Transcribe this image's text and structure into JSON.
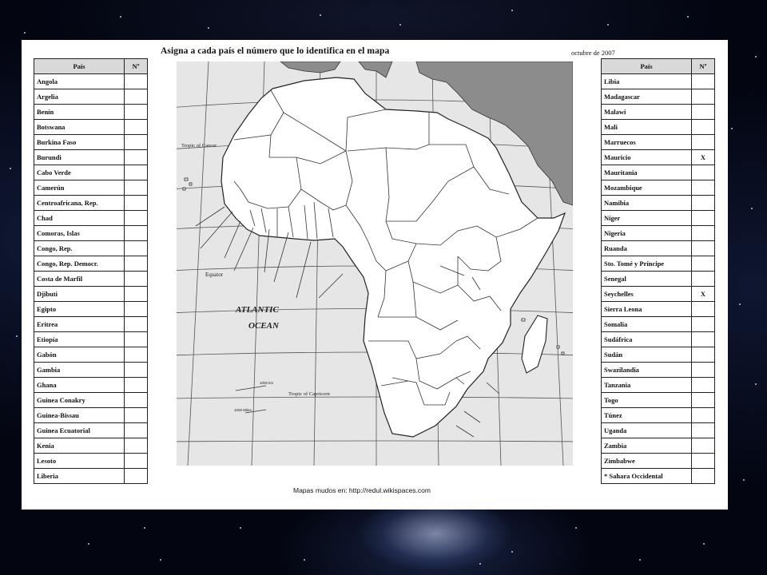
{
  "worksheet": {
    "title": "Asigna a cada país el número que lo identifica en el mapa",
    "date": "octubre de 2007",
    "footer": "Mapas mudos en:  http://redul.wikispaces.com"
  },
  "table_headers": {
    "country": "País",
    "number": "Nº"
  },
  "left_countries": [
    {
      "name": "Angola",
      "mark": ""
    },
    {
      "name": "Argelia",
      "mark": ""
    },
    {
      "name": "Benín",
      "mark": ""
    },
    {
      "name": "Botswana",
      "mark": ""
    },
    {
      "name": "Burkina Faso",
      "mark": ""
    },
    {
      "name": "Burundi",
      "mark": ""
    },
    {
      "name": "Cabo Verde",
      "mark": ""
    },
    {
      "name": "Camerún",
      "mark": ""
    },
    {
      "name": "Centroafricana, Rep.",
      "mark": ""
    },
    {
      "name": "Chad",
      "mark": ""
    },
    {
      "name": "Comoras, Islas",
      "mark": ""
    },
    {
      "name": "Congo, Rep.",
      "mark": ""
    },
    {
      "name": "Congo, Rep. Democr.",
      "mark": ""
    },
    {
      "name": "Costa de Marfil",
      "mark": ""
    },
    {
      "name": "Djibuti",
      "mark": ""
    },
    {
      "name": "Egipto",
      "mark": ""
    },
    {
      "name": "Eritrea",
      "mark": ""
    },
    {
      "name": "Etiopía",
      "mark": ""
    },
    {
      "name": "Gabón",
      "mark": ""
    },
    {
      "name": "Gambia",
      "mark": ""
    },
    {
      "name": "Ghana",
      "mark": ""
    },
    {
      "name": "Guinea Conakry",
      "mark": ""
    },
    {
      "name": "Guinea-Bissau",
      "mark": ""
    },
    {
      "name": "Guinea Ecuatorial",
      "mark": ""
    },
    {
      "name": "Kenia",
      "mark": ""
    },
    {
      "name": "Lesoto",
      "mark": ""
    },
    {
      "name": "Liberia",
      "mark": ""
    }
  ],
  "right_countries": [
    {
      "name": "Libia",
      "mark": ""
    },
    {
      "name": "Madagascar",
      "mark": ""
    },
    {
      "name": "Malawi",
      "mark": ""
    },
    {
      "name": "Mali",
      "mark": ""
    },
    {
      "name": "Marruecos",
      "mark": ""
    },
    {
      "name": "Mauricio",
      "mark": "X"
    },
    {
      "name": "Mauritania",
      "mark": ""
    },
    {
      "name": "Mozambique",
      "mark": ""
    },
    {
      "name": "Namibia",
      "mark": ""
    },
    {
      "name": "Níger",
      "mark": ""
    },
    {
      "name": "Nigeria",
      "mark": ""
    },
    {
      "name": "Ruanda",
      "mark": ""
    },
    {
      "name": "Sto. Tomé y Príncipe",
      "mark": ""
    },
    {
      "name": "Senegal",
      "mark": ""
    },
    {
      "name": "Seychelles",
      "mark": "X"
    },
    {
      "name": "Sierra Leona",
      "mark": ""
    },
    {
      "name": "Somalia",
      "mark": ""
    },
    {
      "name": "Sudáfrica",
      "mark": ""
    },
    {
      "name": "Sudán",
      "mark": ""
    },
    {
      "name": "Swazilandia",
      "mark": ""
    },
    {
      "name": "Tanzania",
      "mark": ""
    },
    {
      "name": "Togo",
      "mark": ""
    },
    {
      "name": "Túnez",
      "mark": ""
    },
    {
      "name": "Uganda",
      "mark": ""
    },
    {
      "name": "Zambia",
      "mark": ""
    },
    {
      "name": "Zimbabwe",
      "mark": ""
    },
    {
      "name": "* Sahara Occidental",
      "mark": ""
    }
  ],
  "map_labels": {
    "tropic_cancer": "Tropic of Cancer",
    "equator": "Equator",
    "ocean_line1": "ATLANTIC",
    "ocean_line2": "OCEAN",
    "tropic_capricorn": "Tropic of Capricorn",
    "scale_km": "1000 km",
    "scale_miles": "1000 Miles"
  },
  "colors": {
    "page_background": "#030611",
    "sheet": "#ffffff",
    "land": "#ffffff",
    "sea": "#e6e6e6",
    "other_land": "#8c8c8c",
    "header_fill": "#d9d9d9"
  }
}
